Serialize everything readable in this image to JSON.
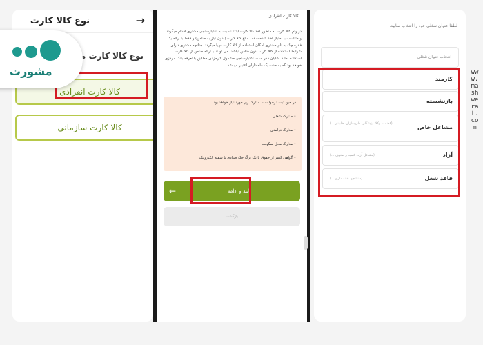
{
  "left_screen": {
    "title": "نوع کالا کارت",
    "subtitle": "نوع کالا کارت مورد",
    "option_individual": "کالا کارت انفرادی",
    "option_organizational": "کالا کارت سازمانی",
    "back_icon": "arrow-right-icon"
  },
  "logo": {
    "text": "مشورت"
  },
  "middle_screen": {
    "heading": "کالا کارت انفرادی",
    "paragraph": "در وام کالا کارت به منظور اخذ کالا کارت ابتدا نسبت به اعتبارسنجی مشتری اقدام میگردد و متناسب با امتیاز اخذ شده سقف مبلغ کالا کارت (بدون نیاز به ضامن) و فقط با ارائه یک فقره چک به نام مشتری امکان استفاده از کالا کارت مهیا میگردد. چنانچه مشتری دارای شرایط استفاده از کالا کارت بدون ضامن نباشد، می تواند با ارائه ضامن از کالا کارت استفاده نماید. شایان ذکر است اعتبارسنجی مشمول کارمزدی مطابق با تعرفه بانک مرکزی خواهد بود که به مدت یک ماه دارای اعتبار میباشد.",
    "docs_intro": "در حین ثبت درخواست، مدارک زیر مورد نیاز خواهد بود:",
    "docs": [
      "• مدارک شغلی",
      "• مدارک درآمدی",
      "• مدارک محل سکونت",
      "• گواهی کسر از حقوق یا یک برگ چک صیادی یا سفته الکترونیک"
    ],
    "confirm_button": "تایید و ادامه",
    "return_button": "بازگشت"
  },
  "right_screen": {
    "prompt": "لطفا عنوان شغلی خود را انتخاب نمایید.",
    "select_label": "انتخاب عنوان شغلی",
    "jobs": [
      {
        "label": "کارمند",
        "hint": ""
      },
      {
        "label": "بازنشسته",
        "hint": ""
      },
      {
        "label": "مشاغل خاص",
        "hint": "(قضات، وکلا، پزشکان، داروسازان، خلبانان...)"
      },
      {
        "label": "آزاد",
        "hint": "(مشاغل آزاد، کسبه و صنوف ...)"
      },
      {
        "label": "فاقد شغل",
        "hint": "(دانشجو، خانه دار و ...)"
      }
    ]
  },
  "watermark": "www.mashwerat.com",
  "colors": {
    "accent_green": "#7aa121",
    "highlight_red": "#d51b23",
    "docs_background": "#fde8da",
    "logo_teal": "#1e9a8f"
  }
}
